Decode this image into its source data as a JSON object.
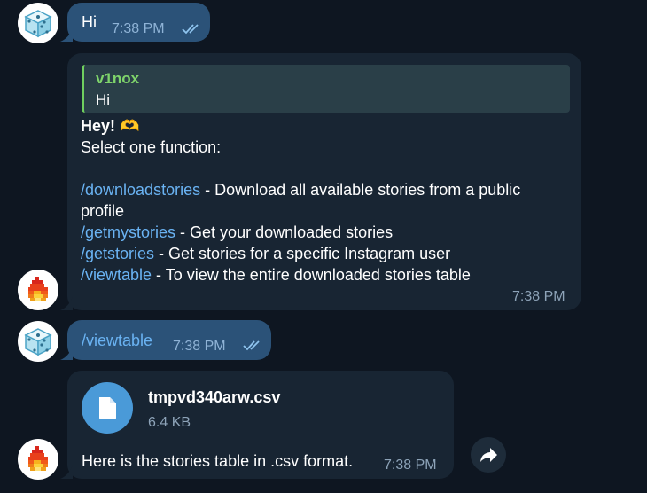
{
  "messages": {
    "m1": {
      "text": "Hi",
      "time": "7:38 PM"
    },
    "m2": {
      "reply_name": "v1nox",
      "reply_text": "Hi",
      "greeting": "Hey! 🫶",
      "prompt": "Select one function:",
      "commands": [
        {
          "cmd": "/downloadstories",
          "desc": " - Download all available stories from a public",
          "desc_cont": "profile"
        },
        {
          "cmd": "/getmystories",
          "desc": " - Get your downloaded stories"
        },
        {
          "cmd": "/getstories",
          "desc": " - Get stories for a specific Instagram user"
        },
        {
          "cmd": "/viewtable",
          "desc": " - To view the entire downloaded stories table"
        }
      ],
      "time": "7:38 PM"
    },
    "m3": {
      "text": "/viewtable",
      "time": "7:38 PM"
    },
    "m4": {
      "file_name": "tmpvd340arw.csv",
      "file_size": "6.4 KB",
      "caption": "Here is the stories table in .csv format.",
      "time": "7:38 PM"
    }
  },
  "icons": {
    "user_avatar": "dice-icon",
    "bot_avatar": "fire-icon",
    "file": "file-icon",
    "forward": "forward-arrow-icon",
    "read_receipt": "double-check-icon"
  },
  "colors": {
    "background": "#0e1621",
    "outgoing_bubble": "#2b5278",
    "incoming_bubble": "#182533",
    "link": "#6ab3f3",
    "quote_name": "#7fd46b"
  }
}
